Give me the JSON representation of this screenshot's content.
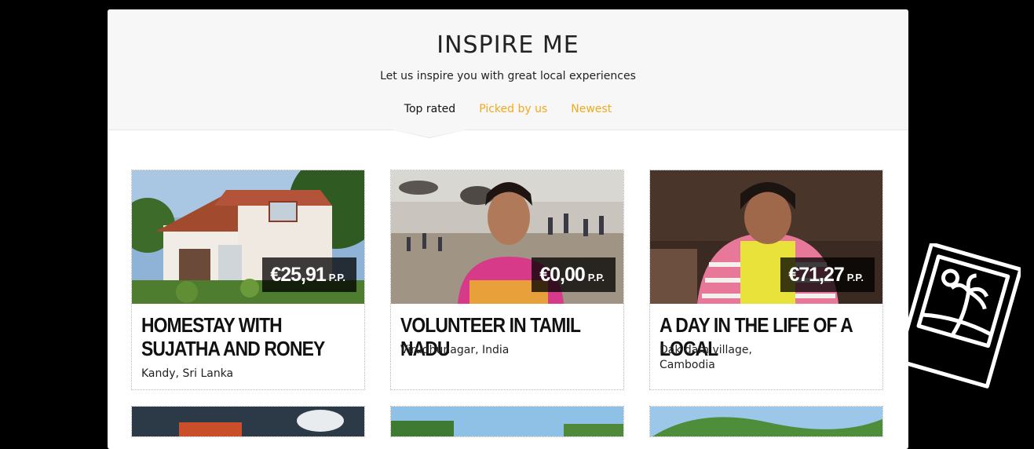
{
  "header": {
    "title": "INSPIRE ME",
    "subtitle": "Let us inspire you with great local experiences",
    "tabs": [
      {
        "label": "Top rated",
        "active": true
      },
      {
        "label": "Picked by us",
        "active": false
      },
      {
        "label": "Newest",
        "active": false
      }
    ]
  },
  "cards": [
    {
      "price": "€25,91",
      "unit": "P.P.",
      "title": "HOMESTAY WITH SUJATHA AND RONEY",
      "location": "Kandy, Sri Lanka"
    },
    {
      "price": "€0,00",
      "unit": "P.P.",
      "title": "VOLUNTEER IN TAMIL NADU",
      "location": "Virudhunagar, India"
    },
    {
      "price": "€71,27",
      "unit": "P.P.",
      "title": "A DAY IN THE LIFE OF A LOCAL",
      "location": "Dak dam village, Cambodia"
    }
  ],
  "colors": {
    "accent": "#f2a91b",
    "background": "#000000",
    "panel": "#ffffff",
    "header_bg": "#f7f7f7"
  },
  "decor": {
    "icon": "polaroid-palm-icon"
  }
}
